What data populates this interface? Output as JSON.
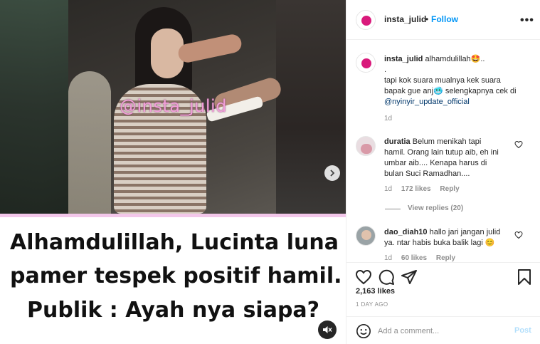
{
  "media": {
    "watermark": "@insta_julid",
    "caption_lines": [
      "Alhamdulillah, Lucinta luna",
      "pamer tespek positif hamil.",
      "Publik : Ayah nya siapa?"
    ]
  },
  "header": {
    "username": "insta_julid",
    "separator": "•",
    "follow_label": "Follow",
    "more_label": "•••"
  },
  "caption": {
    "username": "insta_julid",
    "text_line1": "alhamdulillah🤩..",
    "text_line2": ".",
    "text_line3": "tapi kok suara mualnya kek suara",
    "text_line4": "bapak gue anj🥶 selengkapnya cek di",
    "mention": "@nyinyir_update_official",
    "time": "1d"
  },
  "comments": [
    {
      "username": "duratia",
      "lines": [
        "Belum menikah tapi",
        "hamil. Orang lain tutup aib, eh ini",
        "umbar aib.... Kenapa harus di",
        "bulan Suci Ramadhan...."
      ],
      "time": "1d",
      "likes": "172 likes",
      "reply_label": "Reply",
      "view_replies": "View replies (20)"
    },
    {
      "username": "dao_diah10",
      "lines": [
        "hallo jari jangan julid",
        "ya. ntar habis buka balik lagi 😊"
      ],
      "time": "1d",
      "likes": "60 likes",
      "reply_label": "Reply"
    }
  ],
  "actions": {
    "likes": "2,163 likes",
    "time_ago": "1 DAY AGO"
  },
  "add_comment": {
    "placeholder": "Add a comment...",
    "post_label": "Post"
  },
  "colors": {
    "follow_blue": "#0095f6",
    "post_disabled": "#b2dffc",
    "brand_pink": "#d9197b",
    "border": "#efefef",
    "muted": "#8e8e8e"
  }
}
